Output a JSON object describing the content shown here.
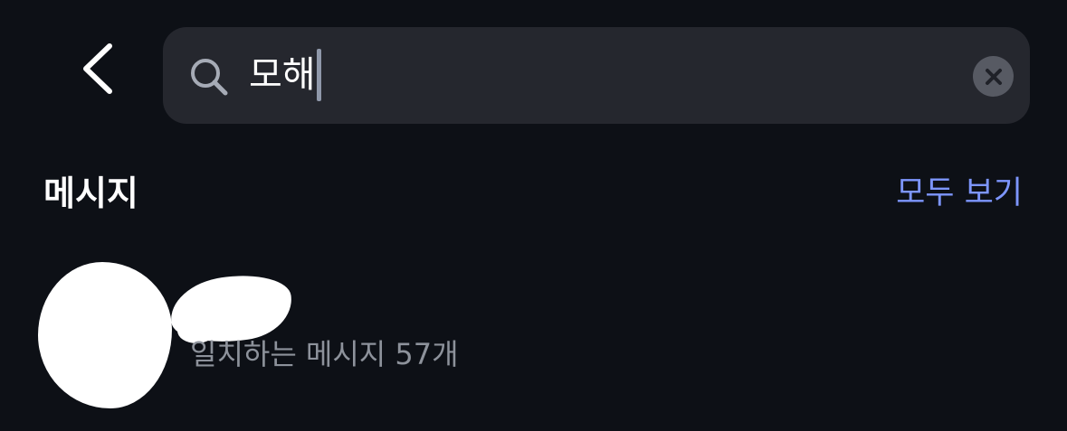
{
  "search": {
    "query": "모해",
    "icon": "search-icon",
    "clear_icon": "clear-icon"
  },
  "navigation": {
    "back_icon": "chevron-left-icon"
  },
  "messages_section": {
    "title": "메시지",
    "see_all_label": "모두 보기"
  },
  "result": {
    "subtitle": "일치하는 메시지 57개"
  },
  "colors": {
    "background": "#0d1016",
    "search_bar": "#25272e",
    "link": "#7d96ff",
    "secondary_text": "#8d929b"
  }
}
